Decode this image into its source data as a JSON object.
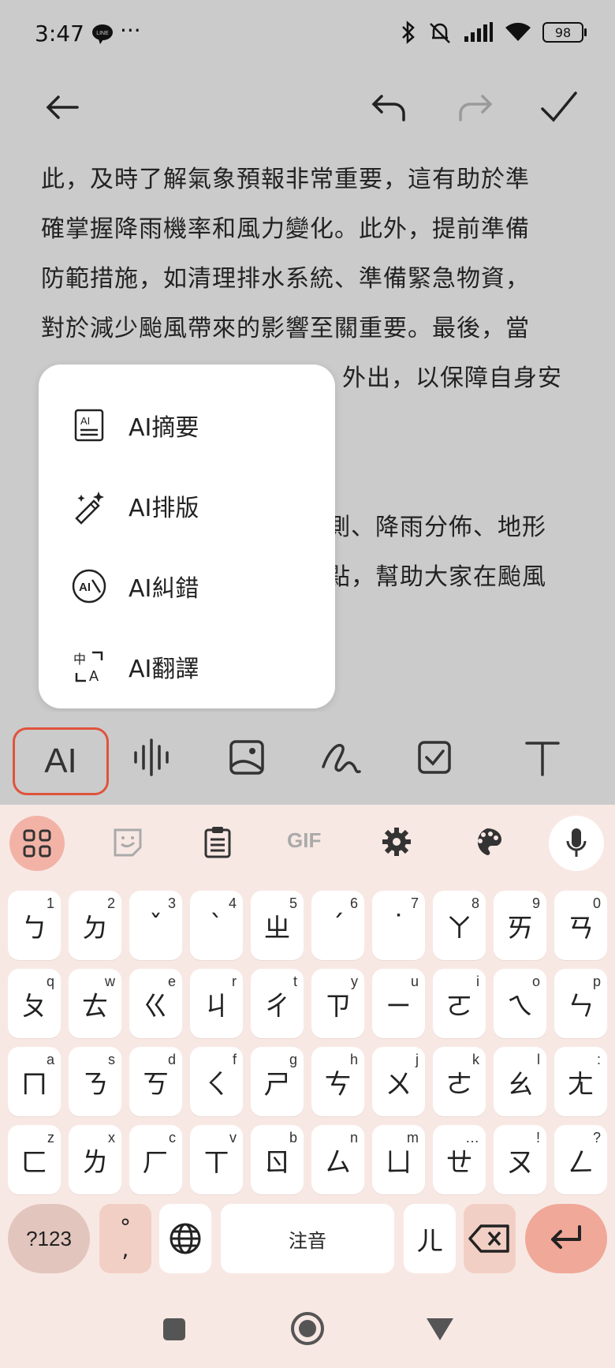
{
  "status": {
    "time": "3:47",
    "dots": "···",
    "battery": "98"
  },
  "content_lines": [
    "此，及時了解氣象預報非常重要，這有助於準",
    "確掌握降雨機率和風力變化。此外，提前準備",
    "防範措施，如清理排水系統、準備緊急物資，",
    "對於減少颱風帶來的影響至關重要。最後，當",
    "外出，以保障自身安"
  ],
  "content_lines_lower": [
    "測、降雨分佈、地形",
    "點，幫助大家在颱風"
  ],
  "ai_menu": [
    {
      "label": "AI摘要",
      "icon": "ai-summary-icon"
    },
    {
      "label": "AI排版",
      "icon": "magic-wand-icon"
    },
    {
      "label": "AI糾錯",
      "icon": "ai-correct-icon"
    },
    {
      "label": "AI翻譯",
      "icon": "translate-icon"
    }
  ],
  "toolbar": {
    "ai_label": "AI"
  },
  "keyboard": {
    "row1": [
      [
        "ㄅ",
        "1"
      ],
      [
        "ㄉ",
        "2"
      ],
      [
        "ˇ",
        "3"
      ],
      [
        "ˋ",
        "4"
      ],
      [
        "ㄓ",
        "5"
      ],
      [
        "ˊ",
        "6"
      ],
      [
        "˙",
        "7"
      ],
      [
        "ㄚ",
        "8"
      ],
      [
        "ㄞ",
        "9"
      ],
      [
        "ㄢ",
        "0"
      ]
    ],
    "row2": [
      [
        "ㄆ",
        "q"
      ],
      [
        "ㄊ",
        "w"
      ],
      [
        "ㄍ",
        "e"
      ],
      [
        "ㄐ",
        "r"
      ],
      [
        "ㄔ",
        "t"
      ],
      [
        "ㄗ",
        "y"
      ],
      [
        "ㄧ",
        "u"
      ],
      [
        "ㄛ",
        "i"
      ],
      [
        "ㄟ",
        "o"
      ],
      [
        "ㄣ",
        "p"
      ]
    ],
    "row3": [
      [
        "ㄇ",
        "a"
      ],
      [
        "ㄋ",
        "s"
      ],
      [
        "ㄎ",
        "d"
      ],
      [
        "ㄑ",
        "f"
      ],
      [
        "ㄕ",
        "g"
      ],
      [
        "ㄘ",
        "h"
      ],
      [
        "ㄨ",
        "j"
      ],
      [
        "ㄜ",
        "k"
      ],
      [
        "ㄠ",
        "l"
      ],
      [
        "ㄤ",
        ":"
      ]
    ],
    "row4": [
      [
        "ㄈ",
        "z"
      ],
      [
        "ㄌ",
        "x"
      ],
      [
        "ㄏ",
        "c"
      ],
      [
        "ㄒ",
        "v"
      ],
      [
        "ㄖ",
        "b"
      ],
      [
        "ㄙ",
        "n"
      ],
      [
        "ㄩ",
        "m"
      ],
      [
        "ㄝ",
        "…"
      ],
      [
        "ㄡ",
        "!"
      ],
      [
        "ㄥ",
        "?"
      ]
    ],
    "symbols_label": "?123",
    "punct_top": "°",
    "punct_bottom": ",",
    "space_label": "注音",
    "er_label": "ㄦ",
    "gif_label": "GIF"
  },
  "colors": {
    "accent": "#e0533c",
    "kb_bg": "#f8e8e4",
    "enter": "#f0a898",
    "dim": "#cbcbcb"
  }
}
